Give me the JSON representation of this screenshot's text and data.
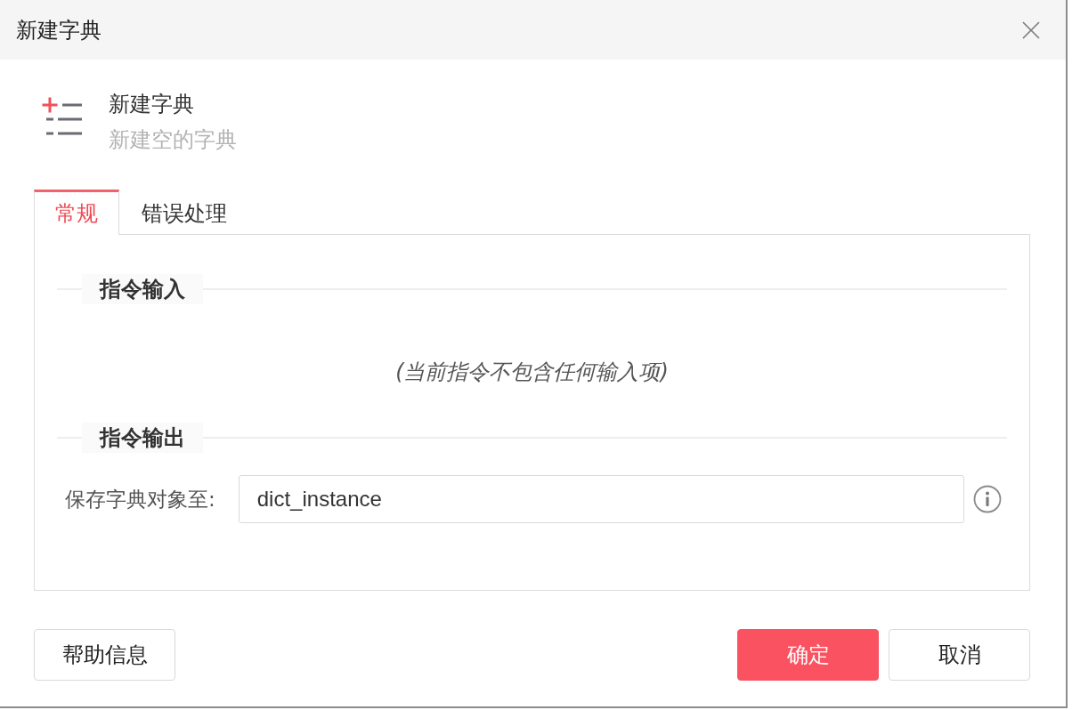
{
  "window": {
    "title": "新建字典"
  },
  "header": {
    "title": "新建字典",
    "subtitle": "新建空的字典"
  },
  "tabs": [
    {
      "label": "常规",
      "selected": true
    },
    {
      "label": "错误处理",
      "selected": false
    }
  ],
  "sections": [
    {
      "title": "指令输入",
      "kind": "empty",
      "message": "(当前指令不包含任何输入项)"
    },
    {
      "title": "指令输出",
      "kind": "fields",
      "fields": [
        {
          "label": "保存字典对象至:",
          "value": "dict_instance"
        }
      ]
    }
  ],
  "footer": {
    "left_buttons": [
      {
        "label": "帮助信息",
        "kind": "default"
      }
    ],
    "right_buttons": [
      {
        "label": "确定",
        "kind": "primary"
      },
      {
        "label": "取消",
        "kind": "default"
      }
    ]
  }
}
